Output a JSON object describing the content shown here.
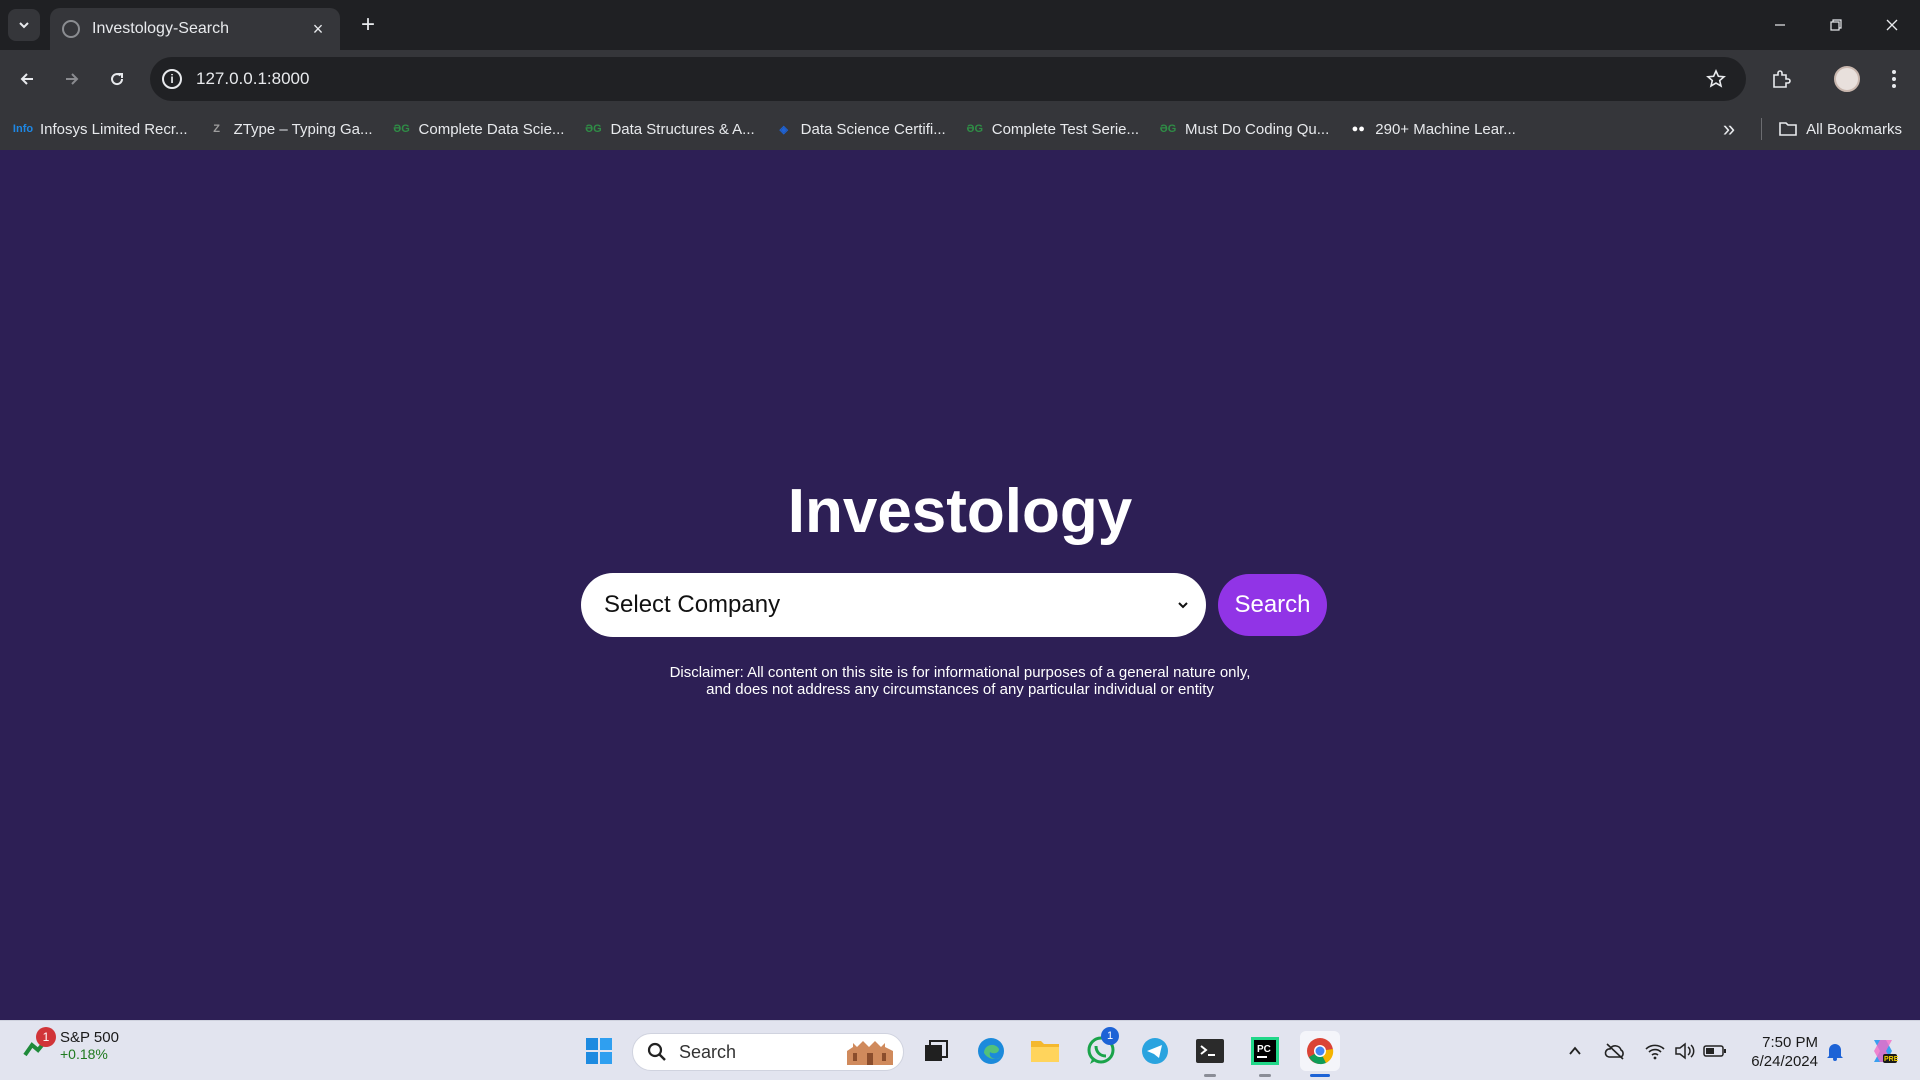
{
  "browser": {
    "tab": {
      "title": "Investology-Search",
      "close_icon": "×"
    },
    "new_tab_label": "+",
    "address": "127.0.0.1:8000",
    "bookmarks": [
      {
        "label": "Infosys Limited Recr...",
        "icon": "infosys-icon",
        "icon_text": "Info",
        "color": "#1e88e5"
      },
      {
        "label": "ZType – Typing Ga...",
        "icon": "ztype-icon",
        "icon_text": "Z",
        "color": "#9e9e9e"
      },
      {
        "label": "Complete Data Scie...",
        "icon": "gfg-icon",
        "icon_text": "ƏG",
        "color": "#2f8d46"
      },
      {
        "label": "Data Structures & A...",
        "icon": "gfg-icon",
        "icon_text": "ƏG",
        "color": "#2f8d46"
      },
      {
        "label": "Data Science Certifi...",
        "icon": "coursera-icon",
        "icon_text": "◈",
        "color": "#1e63d6"
      },
      {
        "label": "Complete Test Serie...",
        "icon": "gfg-icon",
        "icon_text": "ƏG",
        "color": "#2f8d46"
      },
      {
        "label": "Must Do Coding Qu...",
        "icon": "gfg-icon",
        "icon_text": "ƏG",
        "color": "#2f8d46"
      },
      {
        "label": "290+ Machine Lear...",
        "icon": "medium-icon",
        "icon_text": "●●",
        "color": "#ffffff"
      }
    ],
    "all_bookmarks_label": "All Bookmarks",
    "overflow_icon": "»"
  },
  "page": {
    "brand": "Investology",
    "select": {
      "value": "Select Company"
    },
    "search_button": "Search",
    "disclaimer_line1": "Disclaimer: All content on this site is for informational purposes of a general nature only,",
    "disclaimer_line2": "and does not address any circumstances of any particular individual or entity"
  },
  "taskbar": {
    "widget": {
      "name": "S&P 500",
      "value": "+0.18%",
      "badge": "1"
    },
    "search_placeholder": "Search",
    "whatsapp_badge": "1",
    "clock": {
      "time": "7:50 PM",
      "date": "6/24/2024"
    }
  },
  "colors": {
    "page_background": "#2d1f55",
    "accent": "#9134e6",
    "chrome_dark": "#35363a"
  }
}
